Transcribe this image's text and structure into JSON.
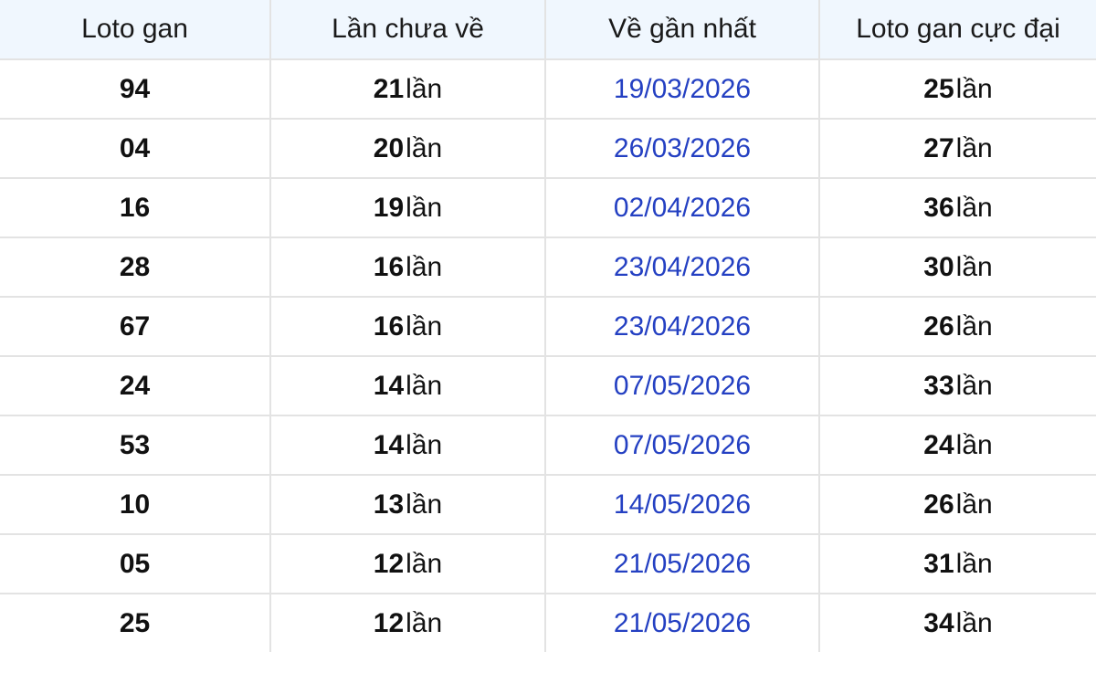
{
  "columns": [
    "Loto gan",
    "Lần chưa về",
    "Về gần nhất",
    "Loto gan cực đại"
  ],
  "unit": "lần",
  "colors": {
    "header_bg": "#f0f7fe",
    "date_text": "#2440c2",
    "grid": "#e3e3e3"
  },
  "rows": [
    {
      "loto": "94",
      "missing": "21",
      "last_date": "19/03/2026",
      "max_gan": "25"
    },
    {
      "loto": "04",
      "missing": "20",
      "last_date": "26/03/2026",
      "max_gan": "27"
    },
    {
      "loto": "16",
      "missing": "19",
      "last_date": "02/04/2026",
      "max_gan": "36"
    },
    {
      "loto": "28",
      "missing": "16",
      "last_date": "23/04/2026",
      "max_gan": "30"
    },
    {
      "loto": "67",
      "missing": "16",
      "last_date": "23/04/2026",
      "max_gan": "26"
    },
    {
      "loto": "24",
      "missing": "14",
      "last_date": "07/05/2026",
      "max_gan": "33"
    },
    {
      "loto": "53",
      "missing": "14",
      "last_date": "07/05/2026",
      "max_gan": "24"
    },
    {
      "loto": "10",
      "missing": "13",
      "last_date": "14/05/2026",
      "max_gan": "26"
    },
    {
      "loto": "05",
      "missing": "12",
      "last_date": "21/05/2026",
      "max_gan": "31"
    },
    {
      "loto": "25",
      "missing": "12",
      "last_date": "21/05/2026",
      "max_gan": "34"
    }
  ]
}
